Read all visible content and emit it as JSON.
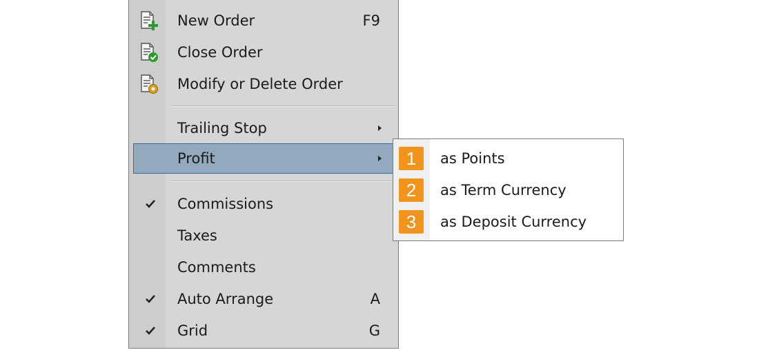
{
  "menu": {
    "items": [
      {
        "label": "New Order",
        "shortcut": "F9",
        "icon": "new-order-icon"
      },
      {
        "label": "Close Order",
        "icon": "close-order-icon"
      },
      {
        "label": "Modify or Delete Order",
        "icon": "modify-order-icon"
      },
      {
        "label": "Trailing Stop",
        "has_submenu": true
      },
      {
        "label": "Profit",
        "has_submenu": true,
        "highlighted": true
      },
      {
        "label": "Commissions",
        "checked": true
      },
      {
        "label": "Taxes",
        "checked": false
      },
      {
        "label": "Comments",
        "checked": false
      },
      {
        "label": "Auto Arrange",
        "shortcut": "A",
        "checked": true
      },
      {
        "label": "Grid",
        "shortcut": "G",
        "checked": true
      }
    ]
  },
  "submenu": {
    "items": [
      {
        "badge": "1",
        "label": "as Points"
      },
      {
        "badge": "2",
        "label": "as Term Currency"
      },
      {
        "badge": "3",
        "label": "as Deposit Currency"
      }
    ]
  },
  "colors": {
    "menu_background": "#d6d6d6",
    "highlight": "#93a9bd",
    "highlight_border": "#2f6aa6",
    "badge": "#f0941e",
    "icon_plus": "#2e9a2e",
    "icon_check": "#2e9a2e",
    "icon_gear": "#d4a21e"
  }
}
